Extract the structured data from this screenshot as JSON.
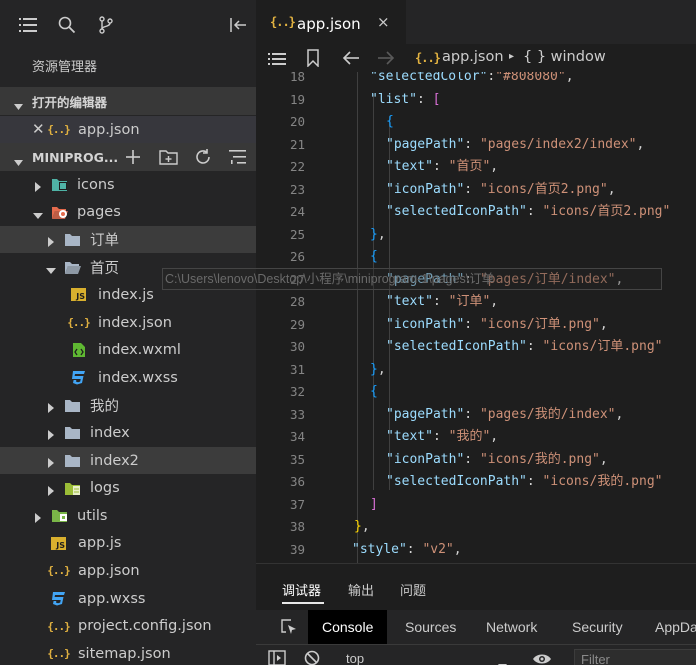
{
  "sidebar": {
    "title": "资源管理器",
    "open_editors": {
      "label": "打开的编辑器",
      "file": "app.json"
    },
    "project": {
      "label": "MINIPROG..."
    },
    "tree": [
      {
        "label": "icons",
        "type": "folder",
        "icon": "folder-image-icon",
        "level": 0
      },
      {
        "label": "pages",
        "type": "folder",
        "icon": "folder-pages-icon",
        "level": 0,
        "open": true
      },
      {
        "label": "订单",
        "type": "folder",
        "icon": "folder-icon",
        "level": 1
      },
      {
        "label": "首页",
        "type": "folder",
        "icon": "folder-open-icon",
        "level": 1,
        "open": true
      },
      {
        "label": "index.js",
        "type": "js",
        "icon": "js-file-icon",
        "level": 2
      },
      {
        "label": "index.json",
        "type": "json",
        "icon": "json-file-icon",
        "level": 2
      },
      {
        "label": "index.wxml",
        "type": "wxml",
        "icon": "wxml-file-icon",
        "level": 2
      },
      {
        "label": "index.wxss",
        "type": "wxss",
        "icon": "css-file-icon",
        "level": 2
      },
      {
        "label": "我的",
        "type": "folder",
        "icon": "folder-icon",
        "level": 1
      },
      {
        "label": "index",
        "type": "folder",
        "icon": "folder-icon",
        "level": 1
      },
      {
        "label": "index2",
        "type": "folder",
        "icon": "folder-icon",
        "level": 1
      },
      {
        "label": "logs",
        "type": "folder",
        "icon": "folder-logs-icon",
        "level": 1
      },
      {
        "label": "utils",
        "type": "folder",
        "icon": "folder-utils-icon",
        "level": 0
      },
      {
        "label": "app.js",
        "type": "js",
        "icon": "js-file-icon",
        "level": 1
      },
      {
        "label": "app.json",
        "type": "json",
        "icon": "json-file-icon",
        "level": 1
      },
      {
        "label": "app.wxss",
        "type": "wxss",
        "icon": "css-file-icon",
        "level": 1
      },
      {
        "label": "project.config.json",
        "type": "json",
        "icon": "json-file-icon",
        "level": 1
      },
      {
        "label": "sitemap.json",
        "type": "json",
        "icon": "json-file-icon",
        "level": 1
      }
    ]
  },
  "editor": {
    "tab": {
      "label": "app.json",
      "close": "×"
    },
    "breadcrumb": {
      "file": "app.json",
      "separator": "▸",
      "symbol": "{ } window"
    },
    "hover_path": "C:\\Users\\lenovo\\Desktop\\小程序\\miniprogram-1\\pages\\订单",
    "lines": [
      {
        "n": "18",
        "tokens": [
          [
            "k",
            "\"selectedColor\""
          ],
          [
            "p",
            ":"
          ],
          [
            "s",
            "\"#808080\""
          ],
          [
            "p",
            ","
          ]
        ]
      },
      {
        "n": "19",
        "tokens": [
          [
            "k",
            "\"list\""
          ],
          [
            "p",
            ": "
          ],
          [
            "b2",
            "["
          ]
        ]
      },
      {
        "n": "20",
        "tokens": [
          [
            "b3",
            "{"
          ]
        ]
      },
      {
        "n": "21",
        "tokens": [
          [
            "k",
            "\"pagePath\""
          ],
          [
            "p",
            ": "
          ],
          [
            "s",
            "\"pages/index2/index\""
          ],
          [
            "p",
            ","
          ]
        ]
      },
      {
        "n": "22",
        "tokens": [
          [
            "k",
            "\"text\""
          ],
          [
            "p",
            ": "
          ],
          [
            "s",
            "\"首页\""
          ],
          [
            "p",
            ","
          ]
        ]
      },
      {
        "n": "23",
        "tokens": [
          [
            "k",
            "\"iconPath\""
          ],
          [
            "p",
            ": "
          ],
          [
            "s",
            "\"icons/首页2.png\""
          ],
          [
            "p",
            ","
          ]
        ]
      },
      {
        "n": "24",
        "tokens": [
          [
            "k",
            "\"selectedIconPath\""
          ],
          [
            "p",
            ": "
          ],
          [
            "s",
            "\"icons/首页2.png\""
          ]
        ]
      },
      {
        "n": "25",
        "tokens": [
          [
            "b3",
            "}"
          ],
          [
            "p",
            ","
          ]
        ]
      },
      {
        "n": "26",
        "tokens": [
          [
            "b3",
            "{"
          ]
        ]
      },
      {
        "n": "27",
        "tokens": [
          [
            "k",
            "\"pagePath\""
          ],
          [
            "p",
            ": "
          ],
          [
            "s",
            "\"pages/订单/index\""
          ],
          [
            "p",
            ","
          ]
        ]
      },
      {
        "n": "28",
        "tokens": [
          [
            "k",
            "\"text\""
          ],
          [
            "p",
            ": "
          ],
          [
            "s",
            "\"订单\""
          ],
          [
            "p",
            ","
          ]
        ]
      },
      {
        "n": "29",
        "tokens": [
          [
            "k",
            "\"iconPath\""
          ],
          [
            "p",
            ": "
          ],
          [
            "s",
            "\"icons/订单.png\""
          ],
          [
            "p",
            ","
          ]
        ]
      },
      {
        "n": "30",
        "tokens": [
          [
            "k",
            "\"selectedIconPath\""
          ],
          [
            "p",
            ": "
          ],
          [
            "s",
            "\"icons/订单.png\""
          ]
        ]
      },
      {
        "n": "31",
        "tokens": [
          [
            "b3",
            "}"
          ],
          [
            "p",
            ","
          ]
        ]
      },
      {
        "n": "32",
        "tokens": [
          [
            "b3",
            "{"
          ]
        ]
      },
      {
        "n": "33",
        "tokens": [
          [
            "k",
            "\"pagePath\""
          ],
          [
            "p",
            ": "
          ],
          [
            "s",
            "\"pages/我的/index\""
          ],
          [
            "p",
            ","
          ]
        ]
      },
      {
        "n": "34",
        "tokens": [
          [
            "k",
            "\"text\""
          ],
          [
            "p",
            ": "
          ],
          [
            "s",
            "\"我的\""
          ],
          [
            "p",
            ","
          ]
        ]
      },
      {
        "n": "35",
        "tokens": [
          [
            "k",
            "\"iconPath\""
          ],
          [
            "p",
            ": "
          ],
          [
            "s",
            "\"icons/我的.png\""
          ],
          [
            "p",
            ","
          ]
        ]
      },
      {
        "n": "36",
        "tokens": [
          [
            "k",
            "\"selectedIconPath\""
          ],
          [
            "p",
            ": "
          ],
          [
            "s",
            "\"icons/我的.png\""
          ]
        ]
      },
      {
        "n": "37",
        "tokens": [
          [
            "b2",
            "]"
          ]
        ]
      },
      {
        "n": "38",
        "tokens": [
          [
            "b1",
            "}"
          ],
          [
            "p",
            ","
          ]
        ]
      },
      {
        "n": "39",
        "tokens": [
          [
            "k",
            "\"style\""
          ],
          [
            "p",
            ": "
          ],
          [
            "s",
            "\"v2\""
          ],
          [
            "p",
            ","
          ]
        ]
      }
    ]
  },
  "panel": {
    "tabs": [
      "调试器",
      "输出",
      "问题"
    ],
    "devtools_tabs": [
      "Console",
      "Sources",
      "Network",
      "Security",
      "AppData"
    ],
    "context": "top",
    "filter_placeholder": "Filter"
  },
  "colors": {
    "accent": "#e3b341",
    "selection": "#37373d",
    "keys": "#9cdcfe",
    "strings": "#ce9178"
  }
}
